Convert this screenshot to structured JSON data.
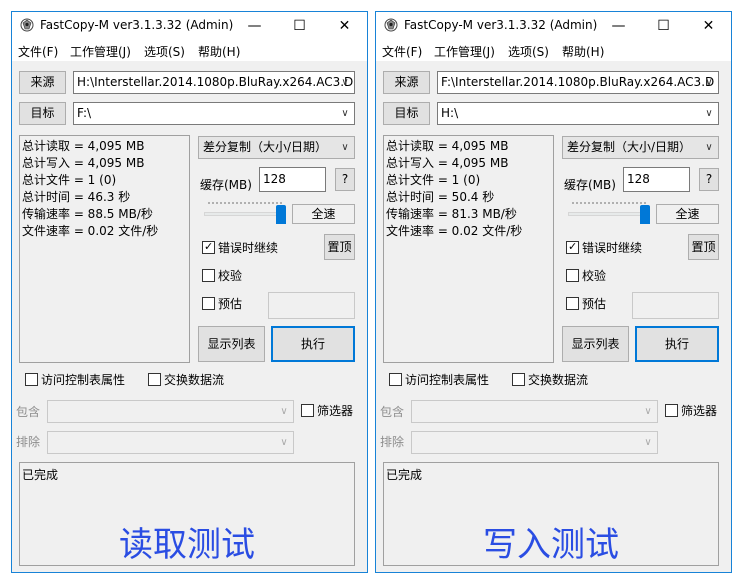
{
  "windows": [
    {
      "title": "FastCopy-M ver3.1.3.32 (Admin)",
      "titlebar_buttons": {
        "minimize": "—",
        "maximize": "☐",
        "close": "✕"
      },
      "menu": [
        "文件(F)",
        "工作管理(J)",
        "选项(S)",
        "帮助(H)"
      ],
      "source_label": "来源",
      "source_path": "H:\\Interstellar.2014.1080p.BluRay.x264.AC3.D",
      "dest_label": "目标",
      "dest_path": "F:\\",
      "stats": [
        "总计读取 = 4,095 MB",
        "总计写入 = 4,095 MB",
        "总计文件 = 1 (0)",
        "总计时间 = 46.3 秒",
        "传输速率 = 88.5 MB/秒",
        "文件速率 = 0.02 文件/秒"
      ],
      "mode": "差分复制（大小/日期）",
      "buffer_label": "缓存(MB)",
      "buffer_value": "128",
      "help_label": "?",
      "speed_label": "全速",
      "speed_level": 1.0,
      "continue_on_error": {
        "label": "错误时继续",
        "checked": true
      },
      "topmost_label": "置顶",
      "verify": {
        "label": "校验",
        "checked": false
      },
      "estimate": {
        "label": "预估",
        "checked": false
      },
      "list_button": "显示列表",
      "execute_button": "执行",
      "acl": {
        "label": "访问控制表属性",
        "checked": false
      },
      "streams": {
        "label": "交换数据流",
        "checked": false
      },
      "include_label": "包含",
      "filter": {
        "label": "筛选器",
        "checked": false
      },
      "exclude_label": "排除",
      "log": "已完成",
      "caption": "读取测试"
    },
    {
      "title": "FastCopy-M ver3.1.3.32 (Admin)",
      "titlebar_buttons": {
        "minimize": "—",
        "maximize": "☐",
        "close": "✕"
      },
      "menu": [
        "文件(F)",
        "工作管理(J)",
        "选项(S)",
        "帮助(H)"
      ],
      "source_label": "来源",
      "source_path": "F:\\Interstellar.2014.1080p.BluRay.x264.AC3.D",
      "dest_label": "目标",
      "dest_path": "H:\\",
      "stats": [
        "总计读取 = 4,095 MB",
        "总计写入 = 4,095 MB",
        "总计文件 = 1 (0)",
        "总计时间 = 50.4 秒",
        "传输速率 = 81.3 MB/秒",
        "文件速率 = 0.02 文件/秒"
      ],
      "mode": "差分复制（大小/日期）",
      "buffer_label": "缓存(MB)",
      "buffer_value": "128",
      "help_label": "?",
      "speed_label": "全速",
      "speed_level": 1.0,
      "continue_on_error": {
        "label": "错误时继续",
        "checked": true
      },
      "topmost_label": "置顶",
      "verify": {
        "label": "校验",
        "checked": false
      },
      "estimate": {
        "label": "预估",
        "checked": false
      },
      "list_button": "显示列表",
      "execute_button": "执行",
      "acl": {
        "label": "访问控制表属性",
        "checked": false
      },
      "streams": {
        "label": "交换数据流",
        "checked": false
      },
      "include_label": "包含",
      "filter": {
        "label": "筛选器",
        "checked": false
      },
      "exclude_label": "排除",
      "log": "已完成",
      "caption": "写入测试"
    }
  ],
  "colors": {
    "window_border": "#1883d7",
    "accent": "#0078d7",
    "caption": "#2a4de3"
  },
  "icons": {
    "app": "fastcopy-icon",
    "dropdown": "chevron-down-icon"
  }
}
